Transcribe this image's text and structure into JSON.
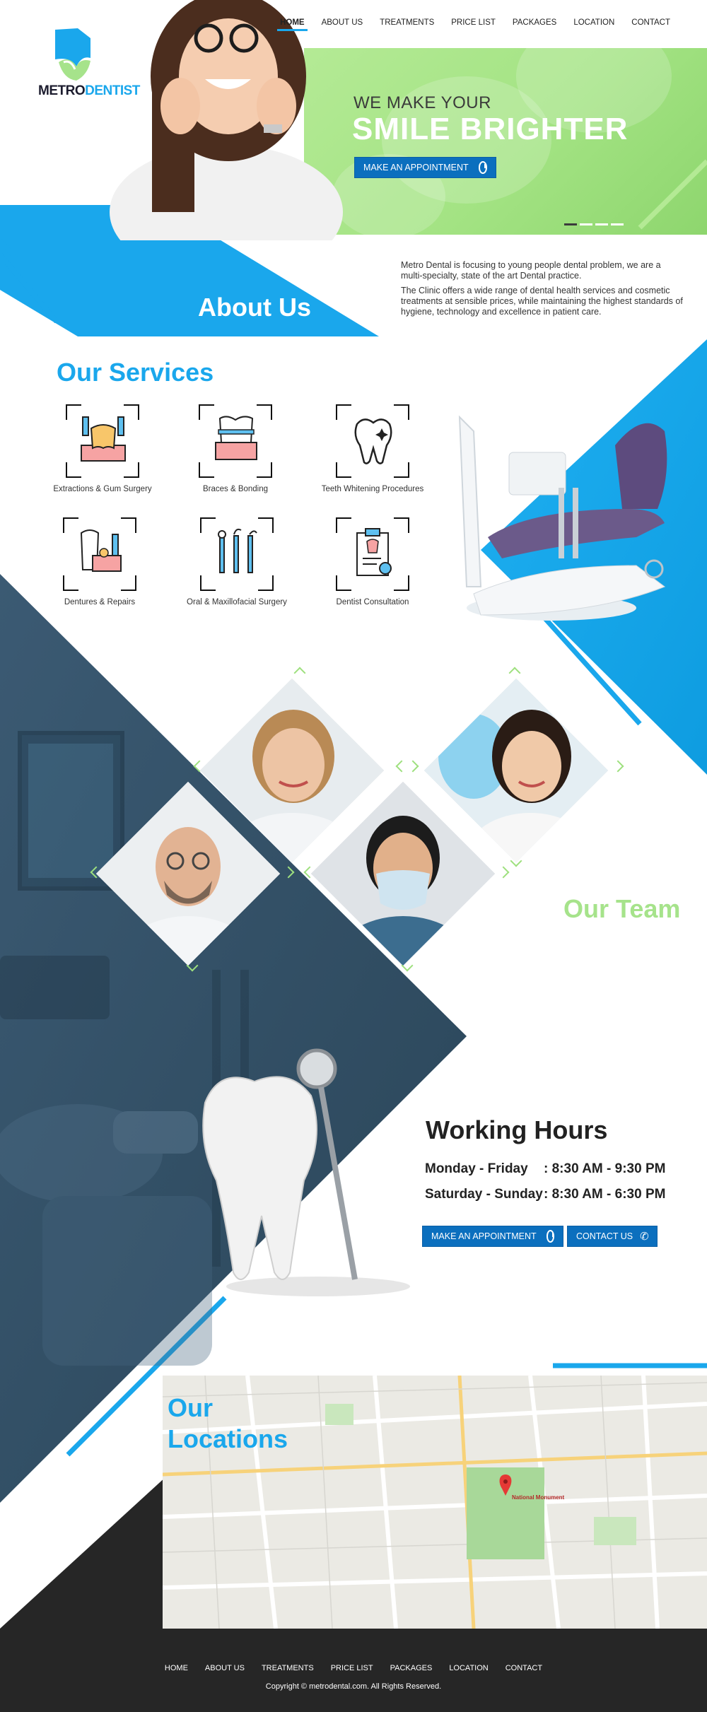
{
  "logo": {
    "brand_part1": "METRO",
    "brand_part2": "DENTIST"
  },
  "nav": {
    "items": [
      {
        "label": "HOME",
        "active": true
      },
      {
        "label": "ABOUT US",
        "active": false
      },
      {
        "label": "TREATMENTS",
        "active": false
      },
      {
        "label": "PRICE LIST",
        "active": false
      },
      {
        "label": "PACKAGES",
        "active": false
      },
      {
        "label": "LOCATION",
        "active": false
      },
      {
        "label": "CONTACT",
        "active": false
      }
    ]
  },
  "hero": {
    "tagline": "WE MAKE YOUR",
    "headline": "SMILE  BRIGHTER",
    "cta_label": "MAKE AN APPOINTMENT",
    "cta_icon": "alarm-clock-icon",
    "slides_total": 4,
    "slide_active": 1
  },
  "about": {
    "title": "About Us",
    "paragraph1": "Metro Dental is focusing to young people dental problem, we are a multi-specialty, state of the art Dental practice.",
    "paragraph2": "The Clinic offers a wide range of dental health services and cosmetic treatments at sensible prices, while maintaining the highest standards of hygiene, technology and excellence in patient care."
  },
  "services": {
    "title": "Our Services",
    "items": [
      {
        "label": "Extractions & Gum Surgery",
        "icon": "tooth-extraction-icon"
      },
      {
        "label": "Braces & Bonding",
        "icon": "braces-icon"
      },
      {
        "label": "Teeth Whitening Procedures",
        "icon": "tooth-whitening-icon"
      },
      {
        "label": "Dentures & Repairs",
        "icon": "denture-icon"
      },
      {
        "label": "Oral & Maxillofacial Surgery",
        "icon": "dental-tools-icon"
      },
      {
        "label": "Dentist Consultation",
        "icon": "consultation-clipboard-icon"
      }
    ]
  },
  "team": {
    "title": "Our Team"
  },
  "hours": {
    "title": "Working Hours",
    "rows": [
      {
        "days": "Monday - Friday",
        "time": ": 8:30 AM - 9:30 PM"
      },
      {
        "days": "Saturday - Sunday",
        "time": ": 8:30 AM - 6:30 PM"
      }
    ],
    "appointment_label": "MAKE AN APPOINTMENT",
    "contact_label": "CONTACT US"
  },
  "locations": {
    "title_line1": "Our",
    "title_line2": "Locations",
    "map_pin_label": "National Monument"
  },
  "footer": {
    "nav": [
      "HOME",
      "ABOUT US",
      "TREATMENTS",
      "PRICE LIST",
      "PACKAGES",
      "LOCATION",
      "CONTACT"
    ],
    "copyright": "Copyright © metrodental.com.  All Rights Reserved."
  },
  "colors": {
    "accent_blue": "#1aa7ec",
    "button_blue": "#0b6fbe",
    "accent_green": "#a6e38b",
    "dark_navy": "#2f4a60",
    "footer": "#262626"
  }
}
